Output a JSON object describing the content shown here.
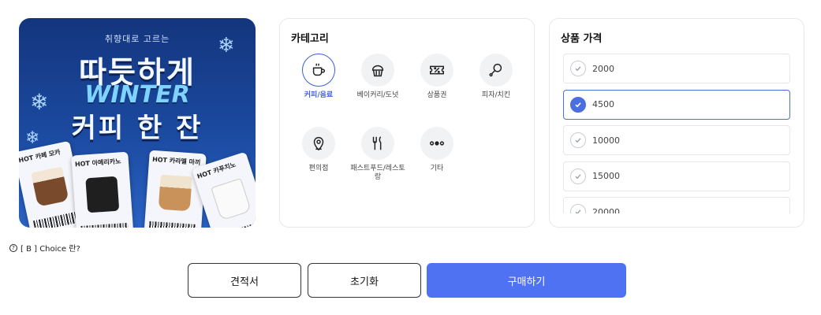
{
  "banner": {
    "subtitle": "취향대로 고르는",
    "title_line1": "따듯하게",
    "title_line2": "WINTER",
    "title_line3": "커피 한 잔",
    "cards": [
      "HOT 카페 모카",
      "HOT 아메리카노",
      "HOT 카라멜 마끼",
      "HOT 카푸치노"
    ]
  },
  "category": {
    "title": "카테고리",
    "items": [
      {
        "label": "커피/음료",
        "icon": "coffee-cup-icon",
        "selected": true
      },
      {
        "label": "베이커리/도넛",
        "icon": "muffin-icon",
        "selected": false
      },
      {
        "label": "상품권",
        "icon": "voucher-icon",
        "selected": false
      },
      {
        "label": "피자/치킨",
        "icon": "chicken-leg-icon",
        "selected": false
      },
      {
        "label": "편의점",
        "icon": "location-pin-icon",
        "selected": false
      },
      {
        "label": "패스트푸드/레스토랑",
        "icon": "fork-knife-icon",
        "selected": false
      },
      {
        "label": "기타",
        "icon": "more-dots-icon",
        "selected": false
      }
    ]
  },
  "price": {
    "title": "상품 가격",
    "options": [
      {
        "value": "2000",
        "selected": false
      },
      {
        "value": "4500",
        "selected": true
      },
      {
        "value": "10000",
        "selected": false
      },
      {
        "value": "15000",
        "selected": false
      },
      {
        "value": "20000",
        "selected": false
      }
    ]
  },
  "help_text": "[ B ] Choice 란?",
  "buttons": {
    "quote": "견적서",
    "reset": "초기화",
    "buy": "구매하기"
  },
  "colors": {
    "accent": "#4f72f3",
    "selected_border": "#3d5fd6",
    "banner_bg": "#1b4aa0"
  }
}
